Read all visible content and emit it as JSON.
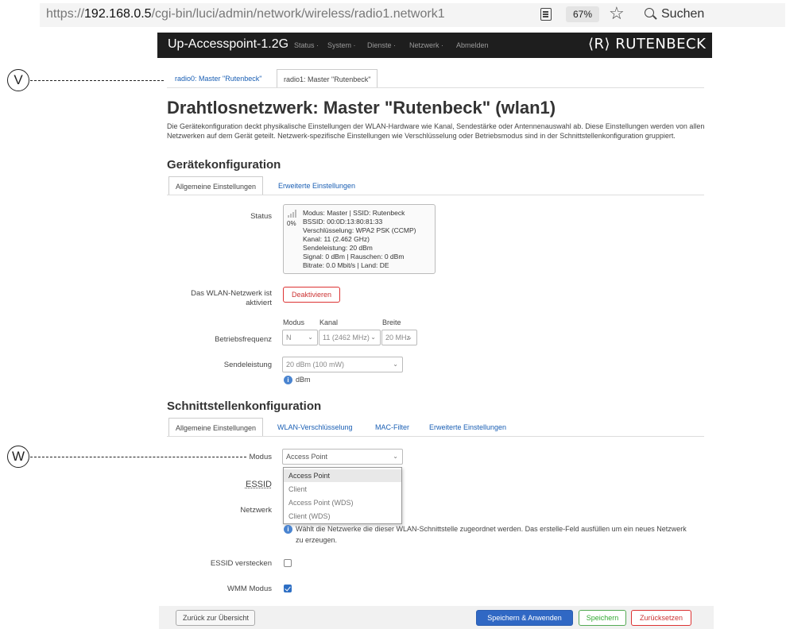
{
  "browser": {
    "url_prefix": "https://",
    "url_host": "192.168.0.5",
    "url_path": "/cgi-bin/luci/admin/network/wireless/radio1.network1",
    "zoom": "67%",
    "search_label": "Suchen"
  },
  "header": {
    "brand": "Up-Accesspoint-1.2G",
    "nav": [
      "Status ·",
      "System ·",
      "Dienste ·",
      "Netzwerk ·",
      "Abmelden"
    ],
    "logo": "⟨R⟩ RUTENBECK"
  },
  "callouts": {
    "v": "V",
    "w": "W"
  },
  "radio_tabs": [
    "radio0: Master \"Rutenbeck\"",
    "radio1: Master \"Rutenbeck\""
  ],
  "page": {
    "title": "Drahtlosnetzwerk: Master \"Rutenbeck\" (wlan1)",
    "description": "Die Gerätekonfiguration deckt physikalische Einstellungen der WLAN-Hardware wie Kanal, Sendestärke oder Antennenauswahl ab. Diese Einstellungen werden von allen Netzwerken auf dem Gerät geteilt. Netzwerk-spezifische Einstellungen wie Verschlüsselung oder Betriebsmodus sind in der Schnittstellenkonfiguration gruppiert."
  },
  "device_config": {
    "heading": "Gerätekonfiguration",
    "tabs": [
      "Allgemeine Einstellungen",
      "Erweiterte Einstellungen"
    ],
    "status_label": "Status",
    "status": {
      "percent": "0%",
      "line1": "Modus: Master | SSID: Rutenbeck",
      "line2": "BSSID: 00:0D:13:80:81:33",
      "line3": "Verschlüsselung: WPA2 PSK (CCMP)",
      "line4": "Kanal: 11 (2.462 GHz)",
      "line5": "Sendeleistung: 20 dBm",
      "line6": "Signal: 0 dBm | Rauschen: 0 dBm",
      "line7": "Bitrate: 0.0 Mbit/s | Land: DE"
    },
    "wlan_active_label_1": "Das WLAN-Netzwerk ist",
    "wlan_active_label_2": "aktiviert",
    "deactivate_button": "Deaktivieren",
    "freq_label": "Betriebsfrequenz",
    "mode_col": "Modus",
    "channel_col": "Kanal",
    "width_col": "Breite",
    "mode_value": "N",
    "channel_value": "11 (2462 MHz)",
    "width_value": "20 MHz",
    "txpower_label": "Sendeleistung",
    "txpower_value": "20 dBm (100 mW)",
    "txpower_unit": "dBm"
  },
  "interface_config": {
    "heading": "Schnittstellenkonfiguration",
    "tabs": [
      "Allgemeine Einstellungen",
      "WLAN-Verschlüsselung",
      "MAC-Filter",
      "Erweiterte Einstellungen"
    ],
    "mode_label": "Modus",
    "mode_value": "Access Point",
    "mode_options": [
      "Access Point",
      "Client",
      "Access Point (WDS)",
      "Client (WDS)"
    ],
    "essid_label": "ESSID",
    "network_label": "Netzwerk",
    "network_hint_1": "Wählt die Netzwerke die dieser WLAN-Schnittstelle zugeordnet werden. Das erstelle-Feld ausfüllen um ein neues Netzwerk",
    "network_hint_2": "zu erzeugen.",
    "hide_essid_label": "ESSID verstecken",
    "wmm_label": "WMM Modus"
  },
  "footer": {
    "back": "Zurück zur Übersicht",
    "save_apply": "Speichern & Anwenden",
    "save": "Speichern",
    "reset": "Zurücksetzen"
  }
}
